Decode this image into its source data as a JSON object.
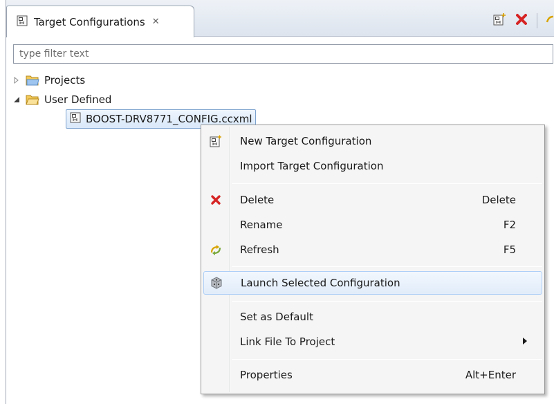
{
  "view": {
    "tab_title": "Target Configurations",
    "tab_close": "✕",
    "toolbar": {
      "icons": [
        "new-target-config-icon",
        "delete-icon",
        "refresh-icon"
      ]
    }
  },
  "filter": {
    "value": "",
    "placeholder": "type filter text"
  },
  "tree": {
    "items": [
      {
        "label": "Projects",
        "expanded": false,
        "icon": "folder-icon"
      },
      {
        "label": "User Defined",
        "expanded": true,
        "icon": "open-folder-icon"
      },
      {
        "label": "BOOST-DRV8771_CONFIG.ccxml",
        "selected": true,
        "icon": "ccxml-file-icon"
      }
    ]
  },
  "context_menu": {
    "items": [
      {
        "label": "New Target Configuration",
        "shortcut": "",
        "icon": "new-target-config-icon"
      },
      {
        "label": "Import Target Configuration",
        "shortcut": ""
      },
      {
        "label": "Delete",
        "shortcut": "Delete",
        "icon": "delete-icon"
      },
      {
        "label": "Rename",
        "shortcut": "F2"
      },
      {
        "label": "Refresh",
        "shortcut": "F5",
        "icon": "refresh-icon"
      },
      {
        "label": "Launch Selected Configuration",
        "shortcut": "",
        "icon": "launch-cube-icon",
        "highlighted": true
      },
      {
        "label": "Set as Default",
        "shortcut": ""
      },
      {
        "label": "Link File To Project",
        "shortcut": "",
        "submenu": true
      },
      {
        "label": "Properties",
        "shortcut": "Alt+Enter"
      }
    ]
  },
  "colors": {
    "delete_red": "#d62424",
    "selection_border": "#7da2ce",
    "menu_background": "#f5f5f5"
  }
}
